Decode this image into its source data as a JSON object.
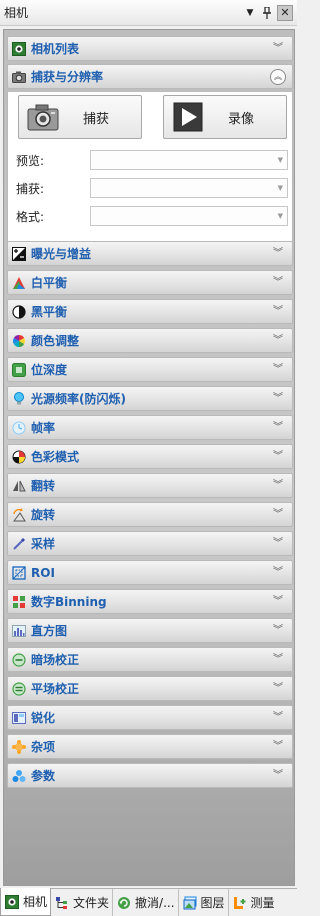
{
  "window": {
    "title": "相机"
  },
  "capture": {
    "header": "捕获与分辨率",
    "capture_button": "捕获",
    "record_button": "录像",
    "fields": [
      {
        "label": "预览:",
        "value": ""
      },
      {
        "label": "捕获:",
        "value": ""
      },
      {
        "label": "格式:",
        "value": ""
      }
    ]
  },
  "sections": [
    {
      "label": "相机列表",
      "icon": "camera-list-icon"
    },
    {
      "label": "捕获与分辨率",
      "icon": "camera-icon"
    },
    {
      "label": "曝光与增益",
      "icon": "exposure-icon"
    },
    {
      "label": "白平衡",
      "icon": "white-balance-icon"
    },
    {
      "label": "黑平衡",
      "icon": "black-balance-icon"
    },
    {
      "label": "颜色调整",
      "icon": "color-wheel-icon"
    },
    {
      "label": "位深度",
      "icon": "bit-depth-icon"
    },
    {
      "label": "光源频率(防闪烁)",
      "icon": "light-bulb-icon"
    },
    {
      "label": "帧率",
      "icon": "frame-rate-icon"
    },
    {
      "label": "色彩模式",
      "icon": "color-mode-icon"
    },
    {
      "label": "翻转",
      "icon": "flip-icon"
    },
    {
      "label": "旋转",
      "icon": "rotate-icon"
    },
    {
      "label": "采样",
      "icon": "sampling-icon"
    },
    {
      "label": "ROI",
      "icon": "roi-icon"
    },
    {
      "label": "数字Binning",
      "icon": "binning-icon"
    },
    {
      "label": "直方图",
      "icon": "histogram-icon"
    },
    {
      "label": "暗场校正",
      "icon": "dark-field-icon"
    },
    {
      "label": "平场校正",
      "icon": "flat-field-icon"
    },
    {
      "label": "锐化",
      "icon": "sharpen-icon"
    },
    {
      "label": "杂项",
      "icon": "misc-icon"
    },
    {
      "label": "参数",
      "icon": "parameters-icon"
    }
  ],
  "tabs": [
    {
      "label": "相机",
      "icon": "camera-tab-icon",
      "active": true
    },
    {
      "label": "文件夹",
      "icon": "folder-tree-icon",
      "active": false
    },
    {
      "label": "撤消/...",
      "icon": "undo-icon",
      "active": false
    },
    {
      "label": "图层",
      "icon": "layers-icon",
      "active": false
    },
    {
      "label": "测量",
      "icon": "measure-icon",
      "active": false
    }
  ],
  "colors": {
    "section_label": "#1f5fb0",
    "panel_bg": "#c0c0c0"
  }
}
